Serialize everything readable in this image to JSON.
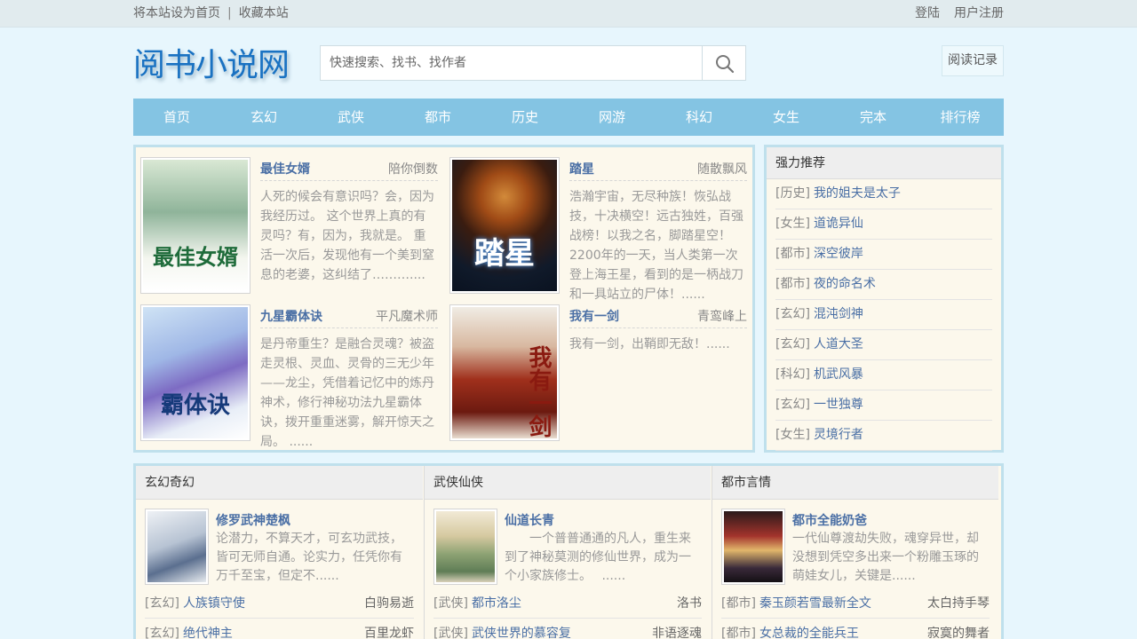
{
  "topbar": {
    "set_home": "将本站设为首页",
    "separator": "|",
    "bookmark": "收藏本站",
    "login": "登陆",
    "register": "用户注册"
  },
  "logo": "阅书小说网",
  "search": {
    "placeholder": "快速搜索、找书、找作者"
  },
  "history_button": "阅读记录",
  "nav": [
    "首页",
    "玄幻",
    "武侠",
    "都市",
    "历史",
    "网游",
    "科幻",
    "女生",
    "完本",
    "排行榜"
  ],
  "featured": [
    {
      "title": "最佳女婿",
      "author": "陪你倒数",
      "cover_text": "最佳女婿",
      "desc": "人死的候会有意识吗？会，因为我经历过。 这个世界上真的有灵吗？有，因为，我就是。 重活一次后，发现他有一个美到窒息的老婆，这纠结了………...."
    },
    {
      "title": "踏星",
      "author": "随散飘风",
      "cover_text": "踏星",
      "desc": "浩瀚宇宙，无尽种族！恢弘战技，十决横空！远古独姓，百强战榜！以我之名，脚踏星空！2200年的一天，当人类第一次登上海王星，看到的是一柄战刀和一具站立的尸体！......"
    },
    {
      "title": "九星霸体诀",
      "author": "平凡魔术师",
      "cover_text": "霸体诀",
      "desc": "是丹帝重生？是融合灵魂？被盗走灵根、灵血、灵骨的三无少年——龙尘，凭借着记忆中的炼丹神术，修行神秘功法九星霸体诀，拨开重重迷雾，解开惊天之局。 ......"
    },
    {
      "title": "我有一剑",
      "author": "青鸾峰上",
      "cover_text": "我有一剑",
      "desc": "我有一剑，出鞘即无敌！......"
    }
  ],
  "recommend": {
    "title": "强力推荐",
    "items": [
      {
        "tag": "[历史]",
        "name": "我的姐夫是太子"
      },
      {
        "tag": "[女生]",
        "name": "道诡异仙"
      },
      {
        "tag": "[都市]",
        "name": "深空彼岸"
      },
      {
        "tag": "[都市]",
        "name": "夜的命名术"
      },
      {
        "tag": "[玄幻]",
        "name": "混沌剑神"
      },
      {
        "tag": "[玄幻]",
        "name": "人道大圣"
      },
      {
        "tag": "[科幻]",
        "name": "机武风暴"
      },
      {
        "tag": "[玄幻]",
        "name": "一世独尊"
      },
      {
        "tag": "[女生]",
        "name": "灵境行者"
      }
    ]
  },
  "categories": [
    {
      "title": "玄幻奇幻",
      "top": {
        "title": "修罗武神楚枫",
        "desc": "论潜力，不算天才，可玄功武技，皆可无师自通。论实力，任凭你有万千至宝，但定不......"
      },
      "rows": [
        {
          "tag": "[玄幻]",
          "name": "人族镇守使",
          "author": "白驹易逝"
        },
        {
          "tag": "[玄幻]",
          "name": "绝代神主",
          "author": "百里龙虾"
        }
      ]
    },
    {
      "title": "武侠仙侠",
      "top": {
        "title": "仙道长青",
        "desc": "　　一个普普通通的凡人，重生来到了神秘莫测的修仙世界，成为一个小家族修士。　 ......"
      },
      "rows": [
        {
          "tag": "[武侠]",
          "name": "都市洛尘",
          "author": "洛书"
        },
        {
          "tag": "[武侠]",
          "name": "武侠世界的慕容复",
          "author": "非语逐魂"
        }
      ]
    },
    {
      "title": "都市言情",
      "top": {
        "title": "都市全能奶爸",
        "desc": "一代仙尊渡劫失败，魂穿异世，却没想到凭空多出来一个粉雕玉琢的萌娃女儿，关键是......"
      },
      "rows": [
        {
          "tag": "[都市]",
          "name": "秦玉颜若雪最新全文",
          "author": "太白持手琴"
        },
        {
          "tag": "[都市]",
          "name": "女总裁的全能兵王",
          "author": "寂寞的舞者"
        }
      ]
    }
  ]
}
